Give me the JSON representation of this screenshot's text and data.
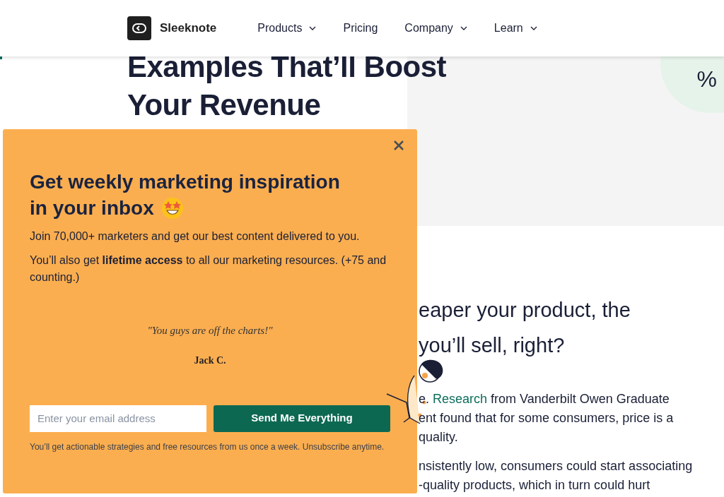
{
  "header": {
    "logo": "Sleeknote",
    "nav": [
      {
        "label": "Products",
        "dropdown": true
      },
      {
        "label": "Pricing",
        "dropdown": false
      },
      {
        "label": "Company",
        "dropdown": true
      },
      {
        "label": "Learn",
        "dropdown": true
      }
    ]
  },
  "hero": {
    "title_lines": [
      "Examples That’ll Boost",
      "Your Revenue"
    ],
    "badge": "%"
  },
  "popup": {
    "title_lines": [
      "Get weekly marketing inspiration",
      "in your inbox"
    ],
    "text": [
      "Join 70,000+  marketers and get our best content delivered to you.",
      "You’ll also get **lifetime access** to all our marketing resources. (+75 and counting.)"
    ],
    "quote": "\"You guys are off the charts!\"",
    "author": "Jack C.",
    "email_placeholder": "Enter your email address",
    "button": "Send Me Everything",
    "footnote": "You’ll get actionable strategies and free resources from us once a week. Unsubscribe anytime."
  },
  "article": {
    "heading_lines": [
      "eaper your product, the",
      "you’ll sell, right?"
    ],
    "paragraphs": [
      [
        {
          "text": "e. "
        },
        {
          "text": "Research",
          "link": true
        },
        {
          "text": " from Vanderbilt Owen Graduate"
        }
      ],
      [
        {
          "text": "ent found that for some consumers, price is a"
        }
      ],
      [
        {
          "text": "quality."
        }
      ],
      [
        {
          "text": "nsistently low, consumers could start associating"
        }
      ],
      [
        {
          "text": "-quality products, which in turn could hurt"
        }
      ]
    ]
  }
}
